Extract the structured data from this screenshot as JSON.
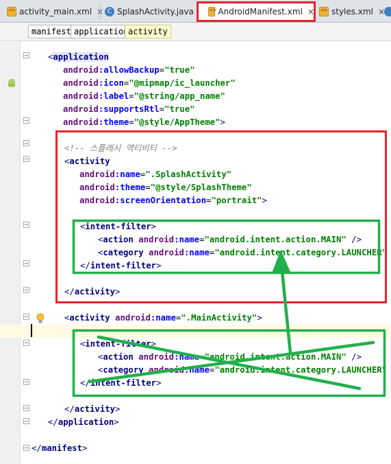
{
  "tabs": [
    {
      "label": "activity_main.xml",
      "icon": "xml-file-icon",
      "active": false
    },
    {
      "label": "SplashActivity.java",
      "icon": "java-class-icon",
      "active": false
    },
    {
      "label": "AndroidManifest.xml",
      "icon": "xml-file-icon",
      "active": true
    },
    {
      "label": "styles.xml",
      "icon": "xml-file-icon",
      "active": false
    }
  ],
  "tab_close_glyph": "×",
  "breadcrumb": [
    "manifest",
    "application",
    "activity"
  ],
  "code": {
    "application_open": "application",
    "attrs_app": [
      {
        "ns": "android",
        "name": "allowBackup",
        "value": "\"true\""
      },
      {
        "ns": "android",
        "name": "icon",
        "value": "\"@mipmap/ic_launcher\""
      },
      {
        "ns": "android",
        "name": "label",
        "value": "\"@string/app_name\""
      },
      {
        "ns": "android",
        "name": "supportsRtl",
        "value": "\"true\""
      },
      {
        "ns": "android",
        "name": "theme",
        "value": "\"@style/AppTheme\""
      }
    ],
    "comment": "<!-- 스플래시 액티비티 -->",
    "splash_tag": "activity",
    "splash_attrs": [
      {
        "ns": "android",
        "name": "name",
        "value": "\".SplashActivity\""
      },
      {
        "ns": "android",
        "name": "theme",
        "value": "\"@style/SplashTheme\""
      },
      {
        "ns": "android",
        "name": "screenOrientation",
        "value": "\"portrait\""
      }
    ],
    "intent_filter": "intent-filter",
    "action_tag": "action",
    "category_tag": "category",
    "action_value": "\"android.intent.action.MAIN\"",
    "category_value": "\"android.intent.category.LAUNCHER\"",
    "main_activity_value": "\".MainActivity\"",
    "activity_close": "activity",
    "application_close": "application",
    "manifest_close": "manifest",
    "ns": "android",
    "name_attr": "name"
  },
  "colors": {
    "highlight_red": "#e8242b",
    "annotation_green": "#22b04b",
    "tag": "#000080",
    "namespace": "#660e7a",
    "attribute": "#0000ff",
    "value": "#008000",
    "comment": "#808080"
  }
}
